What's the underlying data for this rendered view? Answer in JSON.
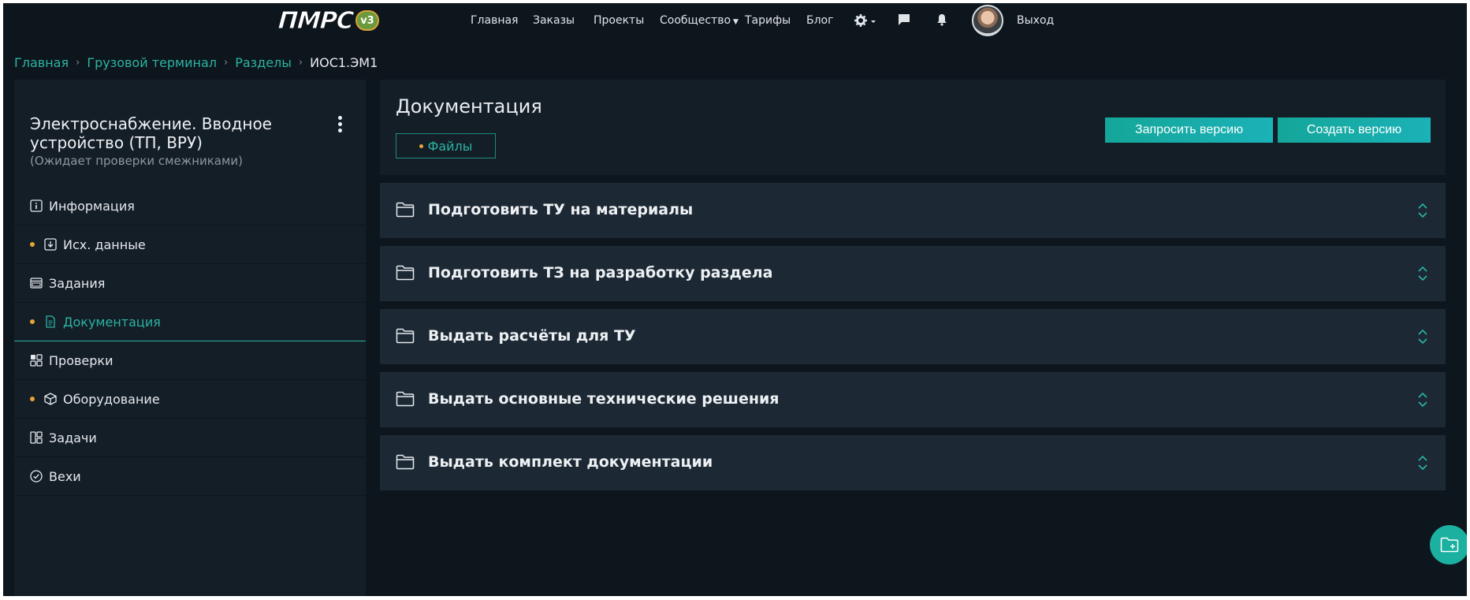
{
  "nav": {
    "logo_text": "ПМРС",
    "logo_badge": "v3",
    "links": [
      "Главная",
      "Заказы",
      "Проекты",
      "Сообщество",
      "Тарифы",
      "Блог"
    ],
    "logout": "Выход",
    "icons": [
      "gear-icon",
      "chat-icon",
      "bell-icon"
    ]
  },
  "breadcrumb": {
    "items": [
      "Главная",
      "Грузовой терминал",
      "Разделы"
    ],
    "current": "ИОС1.ЭМ1",
    "separator": "›"
  },
  "sidebar": {
    "title": "Электроснабжение. Вводное устройство (ТП, ВРУ)",
    "subtitle": "(Ожидает проверки смежниками)",
    "items": [
      {
        "label": "Информация",
        "icon": "info-icon",
        "dot": false,
        "active": false
      },
      {
        "label": "Исх. данные",
        "icon": "download-icon",
        "dot": true,
        "active": false
      },
      {
        "label": "Задания",
        "icon": "tasks-window-icon",
        "dot": false,
        "active": false
      },
      {
        "label": "Документация",
        "icon": "document-icon",
        "dot": true,
        "active": true
      },
      {
        "label": "Проверки",
        "icon": "grid-check-icon",
        "dot": false,
        "active": false
      },
      {
        "label": "Оборудование",
        "icon": "box-icon",
        "dot": true,
        "active": false
      },
      {
        "label": "Задачи",
        "icon": "kanban-icon",
        "dot": false,
        "active": false
      },
      {
        "label": "Вехи",
        "icon": "check-circle-icon",
        "dot": false,
        "active": false
      }
    ]
  },
  "main": {
    "title": "Документация",
    "files_tab": "Файлы",
    "request_version": "Запросить версию",
    "create_version": "Создать версию",
    "sections": [
      "Подготовить ТУ на материалы",
      "Подготовить ТЗ на разработку раздела",
      "Выдать расчёты для ТУ",
      "Выдать основные технические решения",
      "Выдать комплект документации"
    ]
  },
  "colors": {
    "accent": "#2bb3a3",
    "dot": "#e8a435",
    "background": "#0e161d",
    "card": "#1c2935"
  }
}
